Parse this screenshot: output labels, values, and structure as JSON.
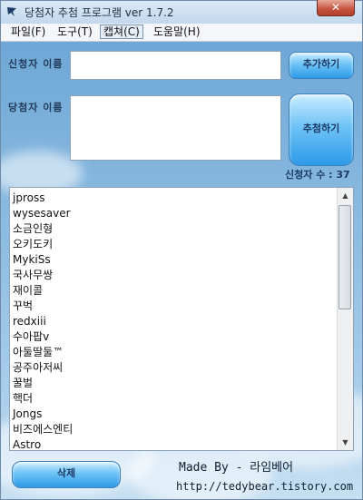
{
  "window": {
    "title": "당첨자 추첨 프로그램 ver 1.7.2",
    "close_label": "✕"
  },
  "menu": {
    "items": [
      "파일(F)",
      "도구(T)",
      "캡쳐(C)",
      "도움말(H)"
    ]
  },
  "form": {
    "applicant_label": "신청자 이름",
    "applicant_value": "",
    "add_button": "추가하기",
    "winner_label": "당첨자 이름",
    "winner_value": "",
    "draw_button": "추첨하기",
    "count_text": "신청자 수 : 37"
  },
  "list": {
    "items": [
      "jpross",
      "wysesaver",
      "소금인형",
      "오키도키",
      "MykiSs",
      "국사무쌍",
      "재이콜",
      "꾸벅",
      "redxiii",
      "수아팝v",
      "아둘딸둘™",
      "공주아저씨",
      "꿀벌",
      "핵더",
      "Jongs",
      "비즈에스엔티",
      "Astro"
    ]
  },
  "footer": {
    "delete_button": "삭제",
    "made_by": "Made By - 라임베어",
    "url": "http://tedybear.tistory.com"
  },
  "colors": {
    "accent": "#2c9ae8",
    "close": "#c4523d"
  }
}
